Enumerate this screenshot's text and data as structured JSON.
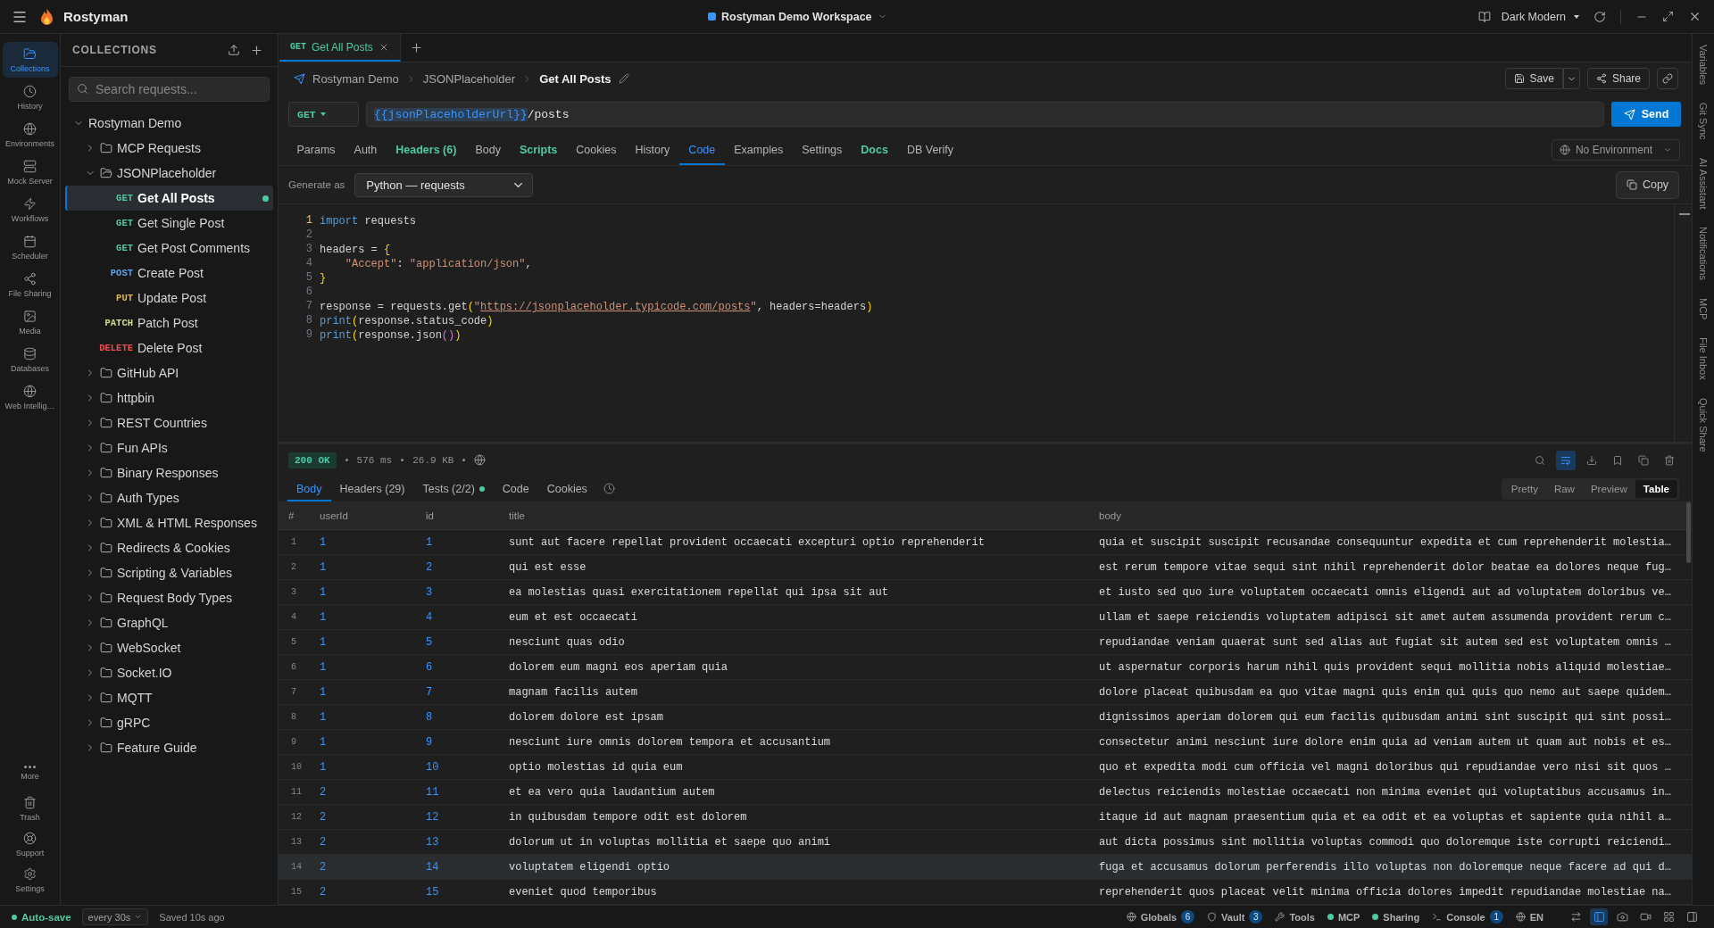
{
  "app": {
    "name": "Rostyman",
    "workspace": "Rostyman Demo Workspace",
    "theme": "Dark Modern"
  },
  "activity_bar": {
    "items": [
      {
        "label": "Collections",
        "selected": true
      },
      {
        "label": "History",
        "selected": false
      },
      {
        "label": "Environments",
        "selected": false
      },
      {
        "label": "Mock Server",
        "selected": false
      },
      {
        "label": "Workflows",
        "selected": false
      },
      {
        "label": "Scheduler",
        "selected": false
      },
      {
        "label": "File Sharing",
        "selected": false
      },
      {
        "label": "Media",
        "selected": false
      },
      {
        "label": "Databases",
        "selected": false
      },
      {
        "label": "Web Intellig…",
        "selected": false
      }
    ],
    "bottom_items": [
      "More",
      "Trash",
      "Support",
      "Settings"
    ]
  },
  "collections": {
    "title": "COLLECTIONS",
    "search": {
      "placeholder": "Search requests..."
    },
    "tree": [
      {
        "kind": "collection",
        "name": "Rostyman Demo",
        "expanded": true,
        "selected": false,
        "children": [
          {
            "kind": "folder",
            "name": "MCP Requests",
            "expanded": false,
            "selected": false
          },
          {
            "kind": "folder",
            "name": "JSONPlaceholder",
            "expanded": true,
            "selected": false,
            "children": [
              {
                "kind": "request",
                "method": "GET",
                "color": "#4ec9a4",
                "name": "Get All Posts",
                "selected": true,
                "indicator": true
              },
              {
                "kind": "request",
                "method": "GET",
                "color": "#4ec9a4",
                "name": "Get Single Post",
                "selected": false,
                "indicator": false
              },
              {
                "kind": "request",
                "method": "GET",
                "color": "#4ec9a4",
                "name": "Get Post Comments",
                "selected": false,
                "indicator": false
              },
              {
                "kind": "request",
                "method": "POST",
                "color": "#5aa2f0",
                "name": "Create Post",
                "selected": false,
                "indicator": false
              },
              {
                "kind": "request",
                "method": "PUT",
                "color": "#e5b643",
                "name": "Update Post",
                "selected": false,
                "indicator": false
              },
              {
                "kind": "request",
                "method": "PATCH",
                "color": "#d3dc8e",
                "name": "Patch Post",
                "selected": false,
                "indicator": false
              },
              {
                "kind": "request",
                "method": "DELETE",
                "color": "#f24c52",
                "name": "Delete Post",
                "selected": false,
                "indicator": false
              }
            ]
          },
          {
            "kind": "folder",
            "name": "GitHub API",
            "expanded": false,
            "selected": false
          },
          {
            "kind": "folder",
            "name": "httpbin",
            "expanded": false,
            "selected": false
          },
          {
            "kind": "folder",
            "name": "REST Countries",
            "expanded": false,
            "selected": false
          },
          {
            "kind": "folder",
            "name": "Fun APIs",
            "expanded": false,
            "selected": false
          },
          {
            "kind": "folder",
            "name": "Binary Responses",
            "expanded": false,
            "selected": false
          },
          {
            "kind": "folder",
            "name": "Auth Types",
            "expanded": false,
            "selected": false
          },
          {
            "kind": "folder",
            "name": "XML & HTML Responses",
            "expanded": false,
            "selected": false
          },
          {
            "kind": "folder",
            "name": "Redirects & Cookies",
            "expanded": false,
            "selected": false
          },
          {
            "kind": "folder",
            "name": "Scripting & Variables",
            "expanded": false,
            "selected": false
          },
          {
            "kind": "folder",
            "name": "Request Body Types",
            "expanded": false,
            "selected": false
          },
          {
            "kind": "folder",
            "name": "GraphQL",
            "expanded": false,
            "selected": false
          },
          {
            "kind": "folder",
            "name": "WebSocket",
            "expanded": false,
            "selected": false
          },
          {
            "kind": "folder",
            "name": "Socket.IO",
            "expanded": false,
            "selected": false
          },
          {
            "kind": "folder",
            "name": "MQTT",
            "expanded": false,
            "selected": false
          },
          {
            "kind": "folder",
            "name": "gRPC",
            "expanded": false,
            "selected": false
          },
          {
            "kind": "folder",
            "name": "Feature Guide",
            "expanded": false,
            "selected": false
          }
        ]
      }
    ]
  },
  "request_tabs": [
    {
      "method": "GET",
      "color": "#4ec9a4",
      "name": "Get All Posts",
      "selected": true
    }
  ],
  "breadcrumb": [
    "Rostyman Demo",
    "JSONPlaceholder",
    "Get All Posts"
  ],
  "actions": {
    "save": "Save",
    "share": "Share"
  },
  "url_bar": {
    "method": "GET",
    "variable": "{{jsonPlaceholderUrl}}",
    "path": "/posts",
    "send": "Send"
  },
  "request_sections": [
    {
      "label": "Params",
      "selected": false,
      "filled": false
    },
    {
      "label": "Auth",
      "selected": false,
      "filled": false
    },
    {
      "label": "Headers (6)",
      "selected": false,
      "filled": true
    },
    {
      "label": "Body",
      "selected": false,
      "filled": false
    },
    {
      "label": "Scripts",
      "selected": false,
      "filled": true
    },
    {
      "label": "Cookies",
      "selected": false,
      "filled": false
    },
    {
      "label": "History",
      "selected": false,
      "filled": false
    },
    {
      "label": "Code",
      "selected": true,
      "filled": false
    },
    {
      "label": "Examples",
      "selected": false,
      "filled": false
    },
    {
      "label": "Settings",
      "selected": false,
      "filled": false
    },
    {
      "label": "Docs",
      "selected": false,
      "filled": true
    },
    {
      "label": "DB Verify",
      "selected": false,
      "filled": false
    }
  ],
  "environment": "No Environment",
  "codegen": {
    "label": "Generate as",
    "language": "Python — requests",
    "copy": "Copy",
    "lines": [
      {
        "number": "1",
        "current": true,
        "tokens": [
          {
            "kind": "keyword",
            "text": "import"
          },
          {
            "kind": "plain",
            "text": " requests"
          }
        ]
      },
      {
        "number": "2",
        "current": false
      },
      {
        "number": "3",
        "current": false,
        "tokens": [
          {
            "kind": "plain",
            "text": "headers = "
          },
          {
            "kind": "bracket",
            "text": "{"
          }
        ]
      },
      {
        "number": "4",
        "current": false,
        "tokens": [
          {
            "kind": "string",
            "text": "    \"Accept\""
          },
          {
            "kind": "plain",
            "text": ": "
          },
          {
            "kind": "string",
            "text": "\"application/json\""
          },
          {
            "kind": "plain",
            "text": ","
          }
        ]
      },
      {
        "number": "5",
        "current": false,
        "tokens": [
          {
            "kind": "bracket",
            "text": "}"
          }
        ]
      },
      {
        "number": "6",
        "current": false
      },
      {
        "number": "7",
        "current": false,
        "tokens": [
          {
            "kind": "plain",
            "text": "response = requests.get"
          },
          {
            "kind": "bracket",
            "text": "("
          },
          {
            "kind": "string",
            "text": "\""
          },
          {
            "kind": "link",
            "text": "https://jsonplaceholder.typicode.com/posts"
          },
          {
            "kind": "string",
            "text": "\""
          },
          {
            "kind": "plain",
            "text": ", headers=headers"
          },
          {
            "kind": "bracket",
            "text": ")"
          }
        ]
      },
      {
        "number": "8",
        "current": false,
        "tokens": [
          {
            "kind": "keyword",
            "text": "print"
          },
          {
            "kind": "bracket",
            "text": "("
          },
          {
            "kind": "plain",
            "text": "response.status_code"
          },
          {
            "kind": "bracket",
            "text": ")"
          }
        ]
      },
      {
        "number": "9",
        "current": false,
        "tokens": [
          {
            "kind": "keyword",
            "text": "print"
          },
          {
            "kind": "bracket",
            "text": "("
          },
          {
            "kind": "plain",
            "text": "response.json"
          },
          {
            "kind": "bracket2",
            "text": "()"
          },
          {
            "kind": "bracket",
            "text": ")"
          }
        ]
      }
    ]
  },
  "response": {
    "status": "200 OK",
    "time": "576 ms",
    "size": "26.9 KB",
    "tools": [
      {
        "on": false
      },
      {
        "on": true
      },
      {
        "on": false
      },
      {
        "on": false
      },
      {
        "on": false
      },
      {
        "on": false
      }
    ],
    "tabs": [
      {
        "label": "Body",
        "selected": true,
        "indicator": false
      },
      {
        "label": "Headers (29)",
        "selected": false,
        "indicator": false
      },
      {
        "label": "Tests (2/2)",
        "selected": false,
        "indicator": true
      },
      {
        "label": "Code",
        "selected": false,
        "indicator": false
      },
      {
        "label": "Cookies",
        "selected": false,
        "indicator": false
      }
    ],
    "views": [
      {
        "label": "Pretty",
        "selected": false
      },
      {
        "label": "Raw",
        "selected": false
      },
      {
        "label": "Preview",
        "selected": false
      },
      {
        "label": "Table",
        "selected": true
      }
    ],
    "table": {
      "columns": [
        "#",
        "userId",
        "id",
        "title",
        "body"
      ],
      "rows": [
        {
          "number": "1",
          "userId": "1",
          "id": "1",
          "title": "sunt aut facere repellat provident occaecati excepturi optio reprehenderit",
          "body": "quia et suscipit suscipit recusandae consequuntur expedita et cum reprehenderit molestia…",
          "selected": false
        },
        {
          "number": "2",
          "userId": "1",
          "id": "2",
          "title": "qui est esse",
          "body": "est rerum tempore vitae sequi sint nihil reprehenderit dolor beatae ea dolores neque fug…",
          "selected": false
        },
        {
          "number": "3",
          "userId": "1",
          "id": "3",
          "title": "ea molestias quasi exercitationem repellat qui ipsa sit aut",
          "body": "et iusto sed quo iure voluptatem occaecati omnis eligendi aut ad voluptatem doloribus ve…",
          "selected": false
        },
        {
          "number": "4",
          "userId": "1",
          "id": "4",
          "title": "eum et est occaecati",
          "body": "ullam et saepe reiciendis voluptatem adipisci sit amet autem assumenda provident rerum c…",
          "selected": false
        },
        {
          "number": "5",
          "userId": "1",
          "id": "5",
          "title": "nesciunt quas odio",
          "body": "repudiandae veniam quaerat sunt sed alias aut fugiat sit autem sed est voluptatem omnis …",
          "selected": false
        },
        {
          "number": "6",
          "userId": "1",
          "id": "6",
          "title": "dolorem eum magni eos aperiam quia",
          "body": "ut aspernatur corporis harum nihil quis provident sequi mollitia nobis aliquid molestiae…",
          "selected": false
        },
        {
          "number": "7",
          "userId": "1",
          "id": "7",
          "title": "magnam facilis autem",
          "body": "dolore placeat quibusdam ea quo vitae magni quis enim qui quis quo nemo aut saepe quidem…",
          "selected": false
        },
        {
          "number": "8",
          "userId": "1",
          "id": "8",
          "title": "dolorem dolore est ipsam",
          "body": "dignissimos aperiam dolorem qui eum facilis quibusdam animi sint suscipit qui sint possi…",
          "selected": false
        },
        {
          "number": "9",
          "userId": "1",
          "id": "9",
          "title": "nesciunt iure omnis dolorem tempora et accusantium",
          "body": "consectetur animi nesciunt iure dolore enim quia ad veniam autem ut quam aut nobis et es…",
          "selected": false
        },
        {
          "number": "10",
          "userId": "1",
          "id": "10",
          "title": "optio molestias id quia eum",
          "body": "quo et expedita modi cum officia vel magni doloribus qui repudiandae vero nisi sit quos …",
          "selected": false
        },
        {
          "number": "11",
          "userId": "2",
          "id": "11",
          "title": "et ea vero quia laudantium autem",
          "body": "delectus reiciendis molestiae occaecati non minima eveniet qui voluptatibus accusamus in…",
          "selected": false
        },
        {
          "number": "12",
          "userId": "2",
          "id": "12",
          "title": "in quibusdam tempore odit est dolorem",
          "body": "itaque id aut magnam praesentium quia et ea odit et ea voluptas et sapiente quia nihil a…",
          "selected": false
        },
        {
          "number": "13",
          "userId": "2",
          "id": "13",
          "title": "dolorum ut in voluptas mollitia et saepe quo animi",
          "body": "aut dicta possimus sint mollitia voluptas commodi quo doloremque iste corrupti reiciendi…",
          "selected": false
        },
        {
          "number": "14",
          "userId": "2",
          "id": "14",
          "title": "voluptatem eligendi optio",
          "body": "fuga et accusamus dolorum perferendis illo voluptas non doloremque neque facere ad qui d…",
          "selected": true
        },
        {
          "number": "15",
          "userId": "2",
          "id": "15",
          "title": "eveniet quod temporibus",
          "body": "reprehenderit quos placeat velit minima officia dolores impedit repudiandae molestiae na…",
          "selected": false
        }
      ]
    }
  },
  "right_rail": [
    "Variables",
    "Git Sync",
    "AI Assistant",
    "Notifications",
    "MCP",
    "File Inbox",
    "Quick Share"
  ],
  "status_bar": {
    "autosave": {
      "label": "Auto-save",
      "on": true,
      "interval": "every 30s",
      "saved": "Saved 10s ago"
    },
    "items": [
      {
        "kind": "icon",
        "label": "Globals",
        "count": "6"
      },
      {
        "kind": "icon",
        "label": "Vault",
        "count": "3"
      },
      {
        "kind": "icon",
        "label": "Tools"
      },
      {
        "kind": "dot",
        "label": "MCP"
      },
      {
        "kind": "dot",
        "label": "Sharing"
      },
      {
        "kind": "icon",
        "label": "Console",
        "count": "1"
      },
      {
        "kind": "icon",
        "label": "EN"
      }
    ],
    "toggles": [
      {
        "on": false
      },
      {
        "on": true
      },
      {
        "on": false
      },
      {
        "on": false
      },
      {
        "on": false
      },
      {
        "on": false
      }
    ]
  }
}
